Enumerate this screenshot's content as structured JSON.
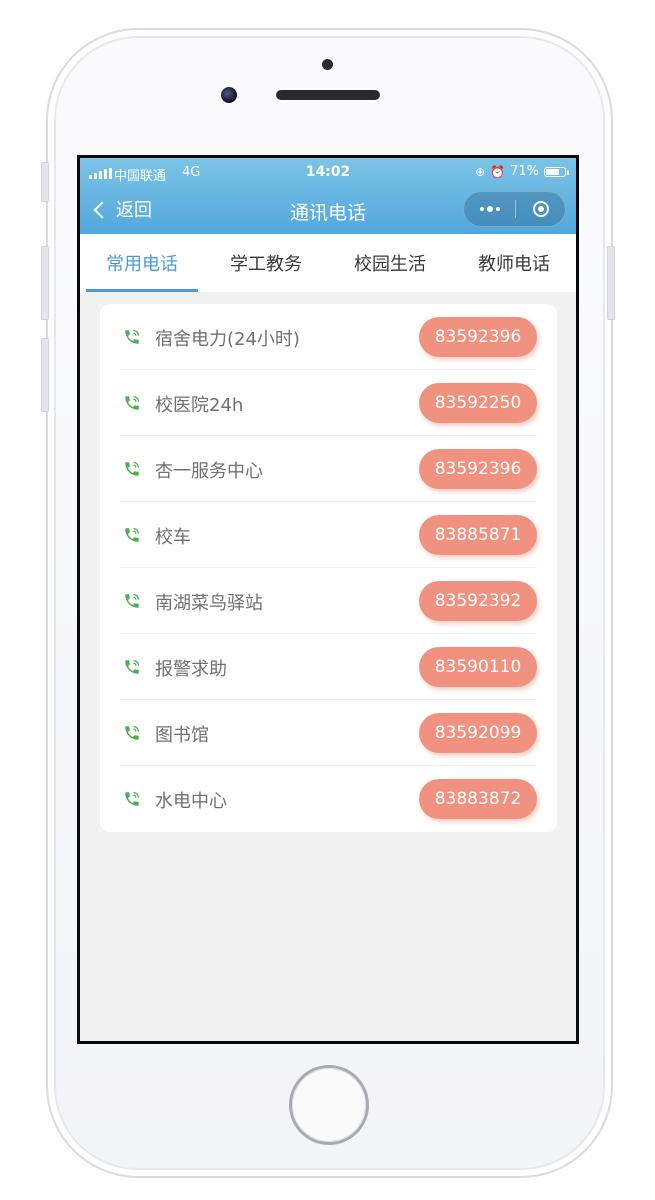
{
  "status_bar": {
    "carrier": "中国联通",
    "network": "4G",
    "time": "14:02",
    "battery": "71%",
    "battery_level": 0.71
  },
  "nav": {
    "back_label": "返回",
    "title": "通讯电话"
  },
  "tabs": [
    {
      "label": "常用电话",
      "active": true
    },
    {
      "label": "学工教务",
      "active": false
    },
    {
      "label": "校园生活",
      "active": false
    },
    {
      "label": "教师电话",
      "active": false
    }
  ],
  "contacts": [
    {
      "name": "宿舍电力(24小时)",
      "number": "83592396"
    },
    {
      "name": "校医院24h",
      "number": "83592250"
    },
    {
      "name": "杏一服务中心",
      "number": "83592396"
    },
    {
      "name": "校车",
      "number": "83885871"
    },
    {
      "name": "南湖菜鸟驿站",
      "number": "83592392"
    },
    {
      "name": "报警求助",
      "number": "83590110"
    },
    {
      "name": "图书馆",
      "number": "83592099"
    },
    {
      "name": "水电中心",
      "number": "83883872"
    }
  ],
  "colors": {
    "header_blue": "#52a7dc",
    "tab_active": "#4d9bd6",
    "number_button": "#f1917f",
    "phone_icon": "#4caf50"
  }
}
